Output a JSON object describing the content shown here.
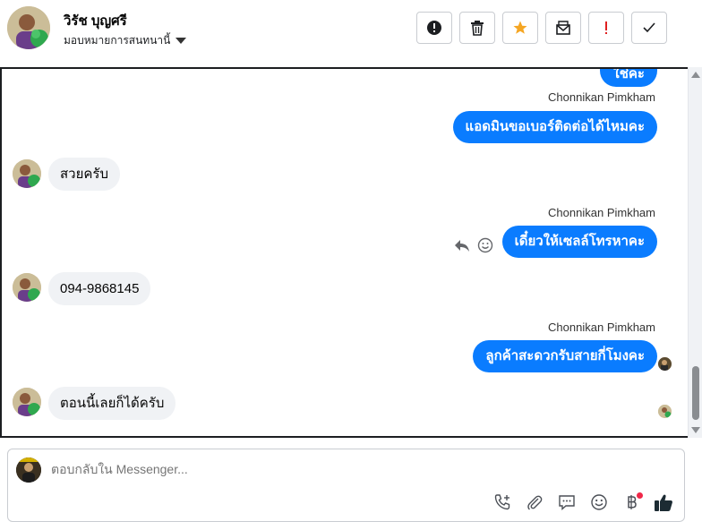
{
  "header": {
    "contact_name": "วิรัช บุญศรี",
    "assign_label": "มอบหมายการสนทนานี้",
    "actions": [
      {
        "name": "spam-button",
        "icon": "alert-circle-icon"
      },
      {
        "name": "delete-button",
        "icon": "trash-icon"
      },
      {
        "name": "star-button",
        "icon": "star-icon"
      },
      {
        "name": "mark-unread-button",
        "icon": "envelope-icon"
      },
      {
        "name": "follow-up-button",
        "icon": "exclamation-icon"
      },
      {
        "name": "done-button",
        "icon": "check-icon"
      }
    ]
  },
  "thread": {
    "messages": [
      {
        "direction": "out",
        "text": "ใช่คะ"
      },
      {
        "direction": "out",
        "sender": "Chonnikan Pimkham",
        "text": "แอดมินขอเบอร์ติดต่อได้ไหมคะ"
      },
      {
        "direction": "in",
        "text": "สวยครับ"
      },
      {
        "direction": "out",
        "sender": "Chonnikan Pimkham",
        "text": "เดี๋ยวให้เซลล์โทรหาคะ"
      },
      {
        "direction": "in",
        "text": "094-9868145"
      },
      {
        "direction": "out",
        "sender": "Chonnikan Pimkham",
        "text": "ลูกค้าสะดวกรับสายกี่โมงคะ"
      },
      {
        "direction": "in",
        "text": "ตอนนี้เลยก็ได้ครับ"
      }
    ]
  },
  "composer": {
    "placeholder": "ตอบกลับใน Messenger..."
  },
  "colors": {
    "accent": "#0a7cff",
    "incoming_bubble": "#f0f2f5",
    "star": "#f5a623",
    "follow_up": "#e02020",
    "notification_dot": "#f02849"
  }
}
